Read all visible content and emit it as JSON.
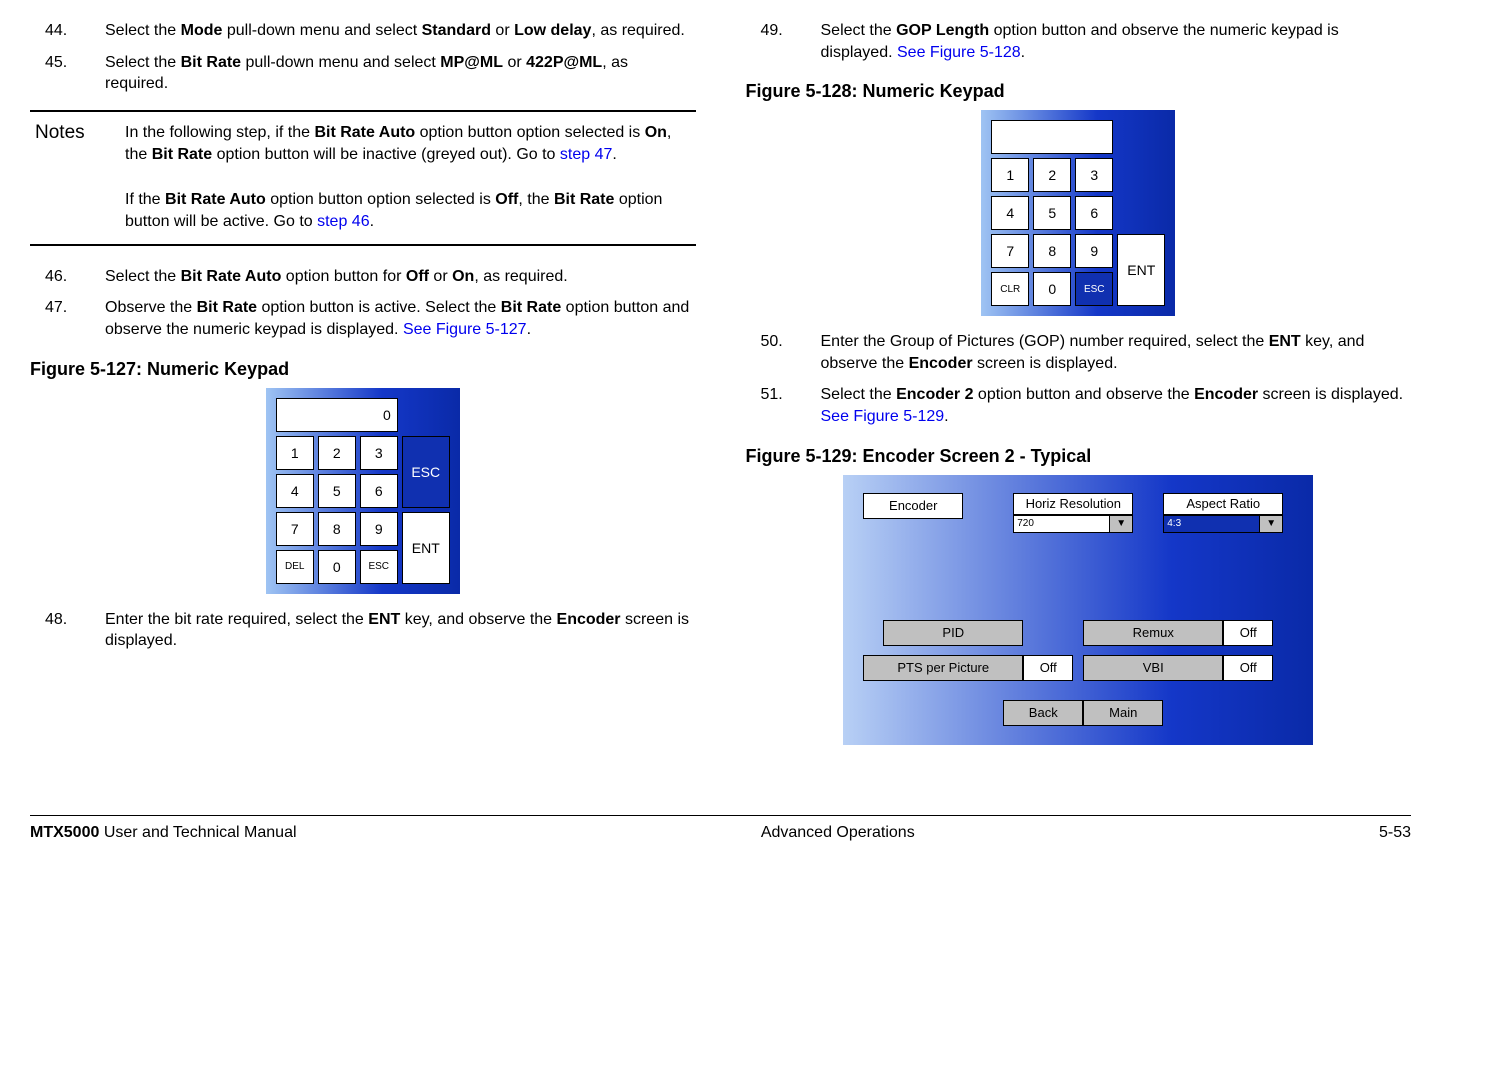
{
  "left": {
    "steps1": [
      {
        "n": "44.",
        "t_before": "Select the ",
        "b1": "Mode",
        "t_mid": " pull-down menu and select ",
        "b2": "Standard",
        "t_mid2": " or ",
        "b3": "Low delay",
        "t_after": ", as required."
      },
      {
        "n": "45.",
        "t_before": "Select the ",
        "b1": "Bit Rate",
        "t_mid": " pull-down menu and select ",
        "b2": "MP@ML",
        "t_mid2": " or ",
        "b3": "422P@ML",
        "t_after": ", as required."
      }
    ],
    "notes_label": "Notes",
    "notes_p1_a": "In the following step, if the ",
    "notes_p1_b": "Bit Rate Auto",
    "notes_p1_c": " option button option selected is ",
    "notes_p1_d": "On",
    "notes_p1_e": ", the ",
    "notes_p1_f": "Bit Rate",
    "notes_p1_g": " option button will be inactive (greyed out).  Go to ",
    "notes_p1_link": "step 47",
    "notes_p1_h": ".",
    "notes_p2_a": "If the ",
    "notes_p2_b": "Bit Rate Auto",
    "notes_p2_c": " option button option selected is ",
    "notes_p2_d": "Off",
    "notes_p2_e": ", the ",
    "notes_p2_f": "Bit Rate",
    "notes_p2_g": " option button will be active.  Go to ",
    "notes_p2_link": "step 46",
    "notes_p2_h": ".",
    "step46_n": "46.",
    "step46_a": "Select the ",
    "step46_b": "Bit Rate Auto",
    "step46_c": " option button for ",
    "step46_d": "Off",
    "step46_e": " or ",
    "step46_f": "On",
    "step46_g": ", as required.",
    "step47_n": "47.",
    "step47_a": "Observe the ",
    "step47_b": "Bit Rate",
    "step47_c": " option button is active.  Select the ",
    "step47_d": "Bit Rate",
    "step47_e": " option button and observe the numeric keypad is displayed.  ",
    "step47_link": "See Figure 5-127",
    "step47_f": ".",
    "fig127": "Figure 5-127:   Numeric Keypad",
    "kp1": {
      "display": "0",
      "k1": "1",
      "k2": "2",
      "k3": "3",
      "k4": "4",
      "k5": "5",
      "k6": "6",
      "k7": "7",
      "k8": "8",
      "k9": "9",
      "k0": "0",
      "del": "DEL",
      "esc": "ESC",
      "esc_big": "ESC",
      "ent": "ENT"
    },
    "step48_n": "48.",
    "step48_a": "Enter the bit rate required, select the ",
    "step48_b": "ENT",
    "step48_c": " key, and observe the ",
    "step48_d": "Encoder",
    "step48_e": " screen is displayed."
  },
  "right": {
    "step49_n": "49.",
    "step49_a": "Select the ",
    "step49_b": "GOP Length",
    "step49_c": " option button and observe the numeric keypad is displayed.  ",
    "step49_link": "See Figure 5-128",
    "step49_d": ".",
    "fig128": "Figure 5-128:   Numeric Keypad",
    "kp2": {
      "display": "",
      "k1": "1",
      "k2": "2",
      "k3": "3",
      "k4": "4",
      "k5": "5",
      "k6": "6",
      "k7": "7",
      "k8": "8",
      "k9": "9",
      "k0": "0",
      "clr": "CLR",
      "esc": "ESC",
      "ent": "ENT"
    },
    "step50_n": "50.",
    "step50_a": "Enter the Group of Pictures (GOP) number required, select the ",
    "step50_b": "ENT",
    "step50_c": " key, and observe the ",
    "step50_d": "Encoder",
    "step50_e": " screen is displayed.",
    "step51_n": "51.",
    "step51_a": "Select the ",
    "step51_b": "Encoder 2",
    "step51_c": " option button and observe the ",
    "step51_d": "Encoder",
    "step51_e": " screen is displayed.  ",
    "step51_link": "See Figure 5-129",
    "step51_f": ".",
    "fig129": "Figure 5-129:   Encoder Screen 2 - Typical",
    "enc": {
      "encoder": "Encoder",
      "horiz": "Horiz Resolution",
      "horiz_val": "720",
      "aspect": "Aspect Ratio",
      "aspect_val": "4:3",
      "pid": "PID",
      "remux": "Remux",
      "remux_val": "Off",
      "pts": "PTS per Picture",
      "pts_val": "Off",
      "vbi": "VBI",
      "vbi_val": "Off",
      "back": "Back",
      "main": "Main"
    }
  },
  "footer": {
    "left_bold": "MTX5000",
    "left_rest": " User and Technical Manual",
    "center": "Advanced Operations",
    "right": "5-53"
  }
}
